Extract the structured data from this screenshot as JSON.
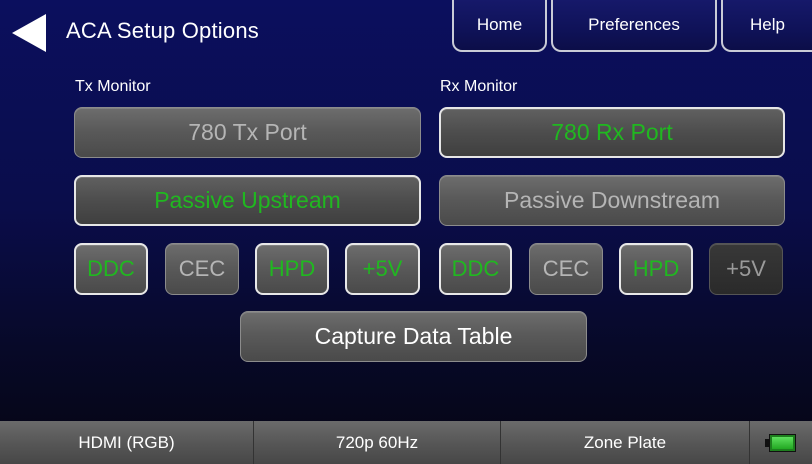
{
  "header": {
    "title": "ACA Setup Options",
    "tabs": {
      "home": "Home",
      "preferences": "Preferences",
      "help": "Help"
    }
  },
  "tx": {
    "label": "Tx Monitor",
    "port": "780 Tx Port",
    "mode": "Passive Upstream",
    "signals": {
      "ddc": "DDC",
      "cec": "CEC",
      "hpd": "HPD",
      "v5": "+5V"
    }
  },
  "rx": {
    "label": "Rx Monitor",
    "port": "780 Rx Port",
    "mode": "Passive Downstream",
    "signals": {
      "ddc": "DDC",
      "cec": "CEC",
      "hpd": "HPD",
      "v5": "+5V"
    }
  },
  "capture": {
    "label": "Capture Data Table"
  },
  "status": {
    "interface": "HDMI (RGB)",
    "format": "720p 60Hz",
    "pattern": "Zone Plate",
    "battery_level": 1.0
  },
  "colors": {
    "active_green": "#20b820",
    "background": "#0b0f5e",
    "button_gray": "#5a5a5a"
  },
  "icons": {
    "back": "back-arrow-icon",
    "battery": "battery-icon"
  }
}
